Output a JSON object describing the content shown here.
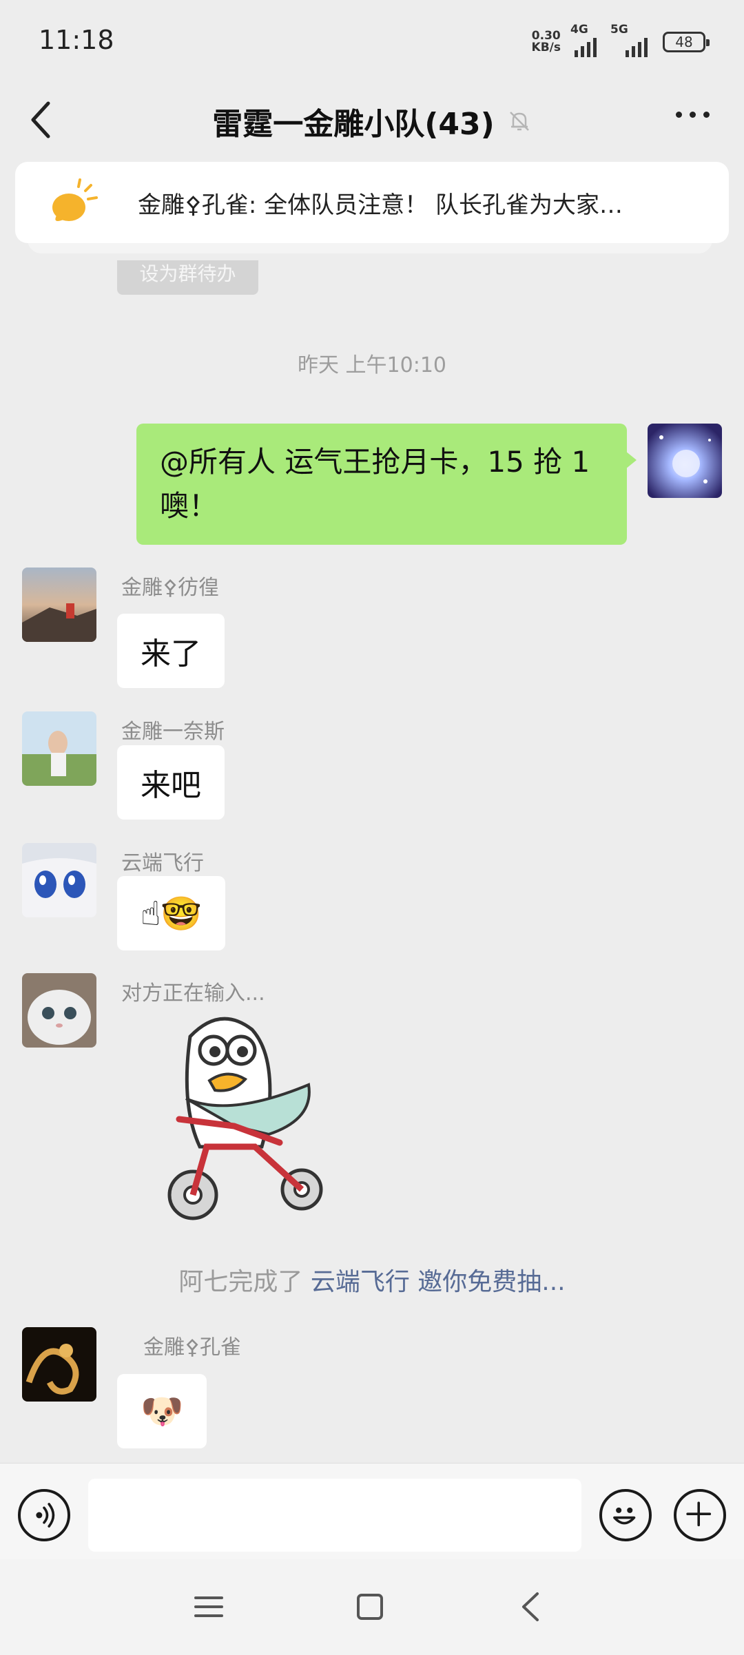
{
  "status_bar": {
    "time": "11:18",
    "net_speed_value": "0.30",
    "net_speed_unit": "KB/s",
    "sim1_label": "4G",
    "sim2_label": "5G",
    "battery": "48"
  },
  "header": {
    "title": "雷霆一金雕小队(43)"
  },
  "pinned": {
    "text": "金雕⚴孔雀: 全体队员注意！  队长孔雀为大家…"
  },
  "todo_chip": "设为群待办",
  "timestamp": "昨天 上午10:10",
  "messages": [
    {
      "sender": "",
      "text_line1": "@所有人  运气王抢月卡，15 抢 1",
      "text_line2": "噢！"
    },
    {
      "sender": "金雕⚴彷徨",
      "text": "来了"
    },
    {
      "sender": "金雕一奈斯",
      "text": "来吧"
    },
    {
      "sender": "云端飞行",
      "text": "☝🤓"
    },
    {
      "sender": "对方正在输入...",
      "text": ""
    },
    {
      "sender": "金雕⚴孔雀",
      "text": "🐶"
    }
  ],
  "system_notice": {
    "prefix": "阿七完成了",
    "link_text": "云端飞行 邀你免费抽..."
  },
  "icons": {
    "back": "back-chevron-icon",
    "mute": "mute-bell-icon",
    "more": "more-dots-icon",
    "pinned": "announcement-bulb-icon",
    "voice": "voice-icon",
    "emoji": "emoji-icon",
    "plus": "plus-icon"
  },
  "colors": {
    "background": "#ededed",
    "own_bubble": "#a9ea7a",
    "link": "#576b95"
  }
}
